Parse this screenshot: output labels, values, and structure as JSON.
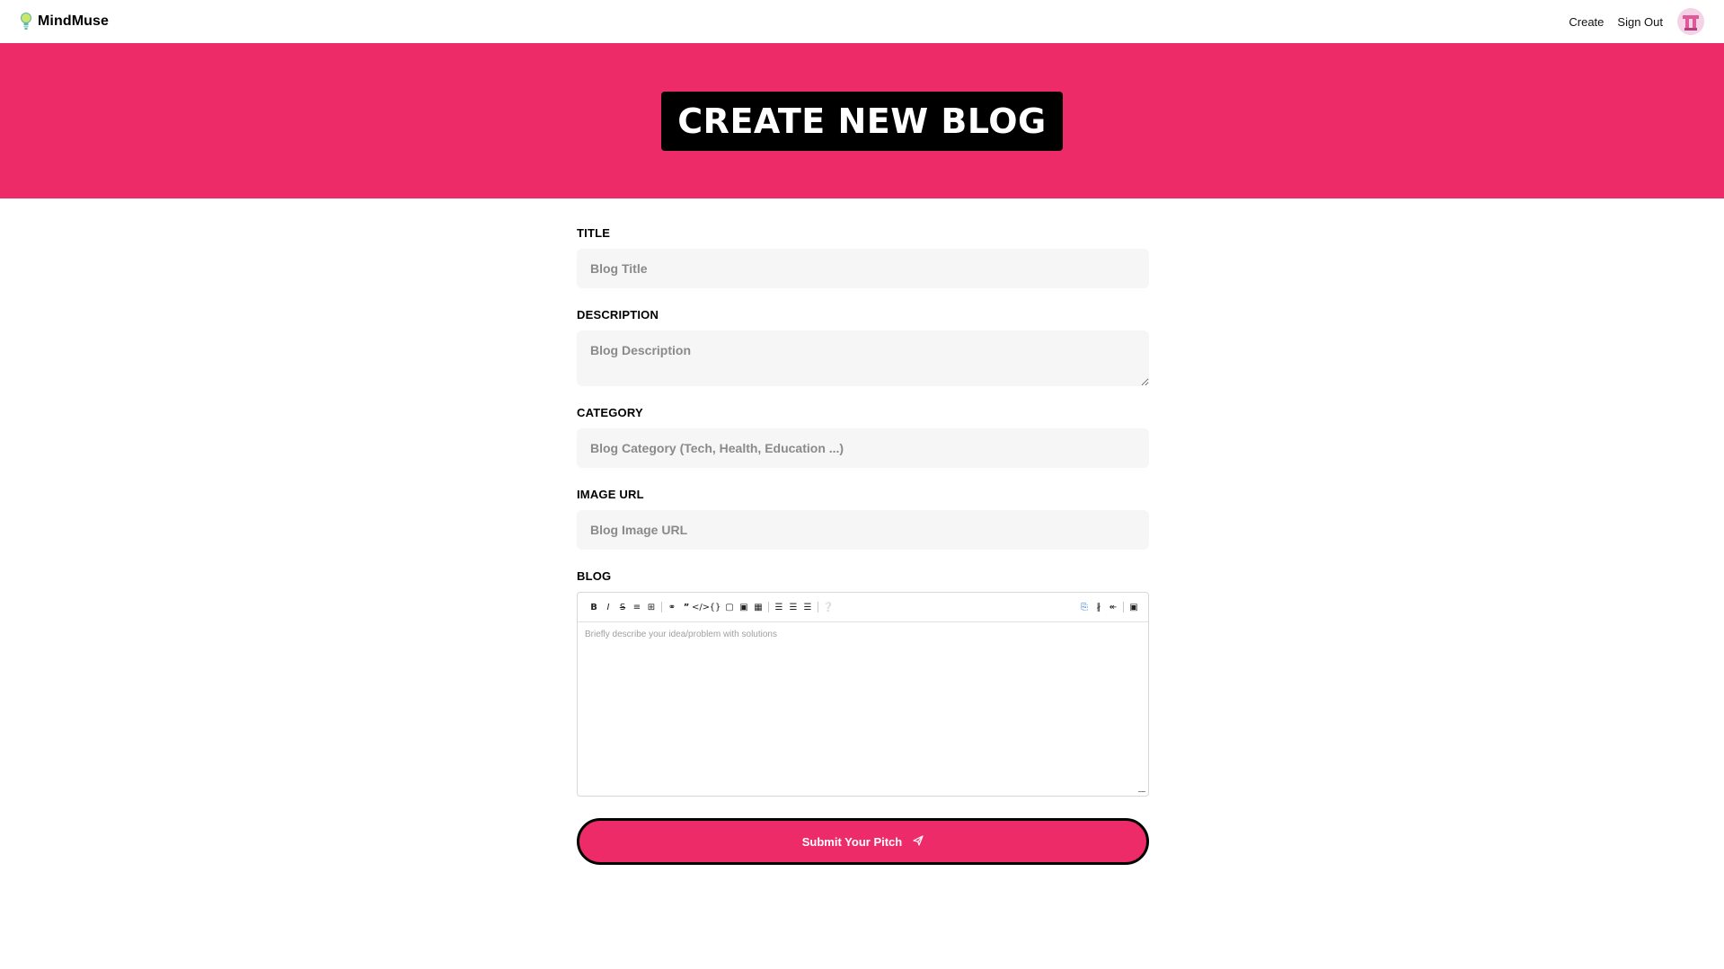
{
  "nav": {
    "brand": "MindMuse",
    "links": {
      "create": "Create",
      "sign_out": "Sign Out"
    }
  },
  "hero": {
    "title": "CREATE NEW BLOG"
  },
  "form": {
    "title": {
      "label": "TITLE",
      "placeholder": "Blog Title"
    },
    "description": {
      "label": "DESCRIPTION",
      "placeholder": "Blog Description"
    },
    "category": {
      "label": "CATEGORY",
      "placeholder": "Blog Category (Tech, Health, Education ...)"
    },
    "image_url": {
      "label": "IMAGE URL",
      "placeholder": "Blog Image URL"
    },
    "blog": {
      "label": "BLOG",
      "placeholder": "Briefly describe your idea/problem with solutions",
      "toolbar": [
        "bold-icon",
        "italic-icon",
        "strikethrough-icon",
        "hr-icon",
        "title-icon",
        "link-icon",
        "quote-icon",
        "code-icon",
        "code-block-icon",
        "comment-icon",
        "image-icon",
        "table-icon",
        "unordered-list-icon",
        "ordered-list-icon",
        "checked-list-icon",
        "help-icon"
      ],
      "view_modes": [
        "edit-mode-icon",
        "live-mode-icon",
        "preview-mode-icon",
        "fullscreen-icon"
      ]
    },
    "submit_label": "Submit Your Pitch"
  },
  "colors": {
    "accent": "#ee2b69",
    "hero_title_bg": "#000000",
    "input_bg": "#f6f6f6"
  }
}
